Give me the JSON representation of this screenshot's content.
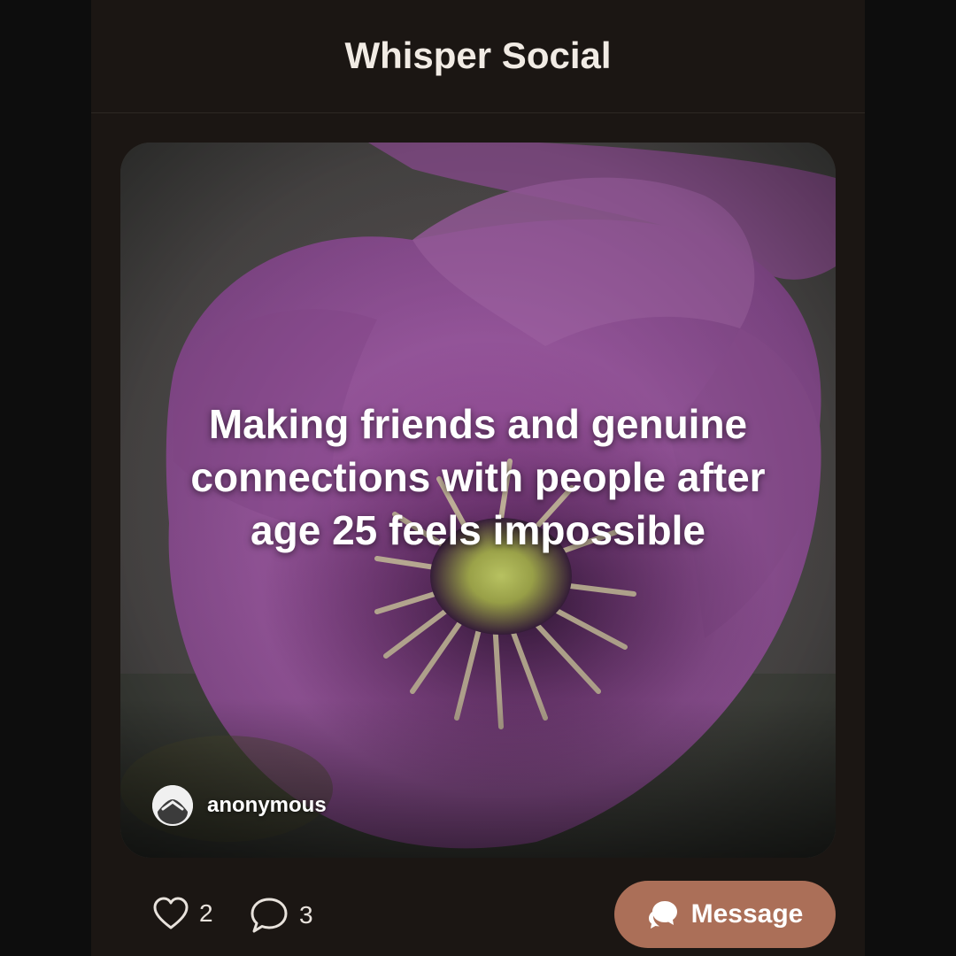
{
  "app": {
    "title": "Whisper Social"
  },
  "post": {
    "text": "Making friends and genuine connections with people after age 25 feels impossible",
    "author": "anonymous",
    "likes": "2",
    "comments": "3"
  },
  "actions": {
    "message_label": "Message"
  },
  "icons": {
    "like": "heart-icon",
    "comment": "comment-bubble-icon",
    "message": "chat-bubbles-icon",
    "avatar": "anonymous-mask-icon"
  },
  "colors": {
    "background": "#1b1613",
    "accent": "#ab6f58",
    "text": "#f1ebe4"
  }
}
